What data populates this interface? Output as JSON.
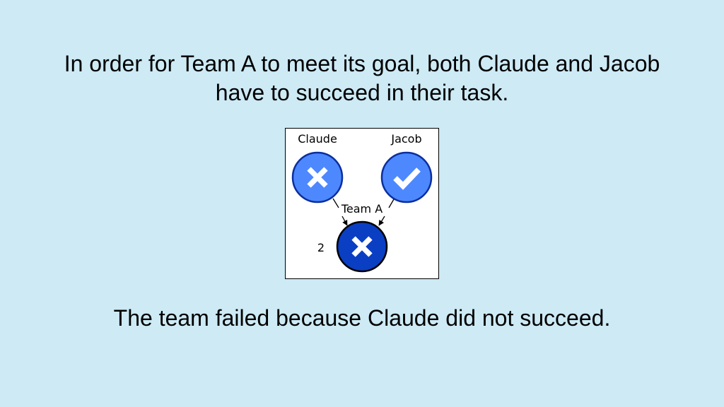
{
  "intro": {
    "line1": "In order for Team A to meet its goal, both Claude and Jacob",
    "line2": "have to succeed in their task."
  },
  "diagram": {
    "members": [
      {
        "label": "Claude",
        "status": "failed",
        "icon": "x-icon",
        "color": "#4d88ff"
      },
      {
        "label": "Jacob",
        "status": "succeeded",
        "icon": "check-icon",
        "color": "#4d88ff"
      }
    ],
    "team": {
      "label": "Team A",
      "status": "failed",
      "icon": "x-icon",
      "color": "#0a3fc4",
      "threshold": "2"
    },
    "node_border_color": "#0b2f9e"
  },
  "conclusion": "The team failed because Claude did not succeed."
}
